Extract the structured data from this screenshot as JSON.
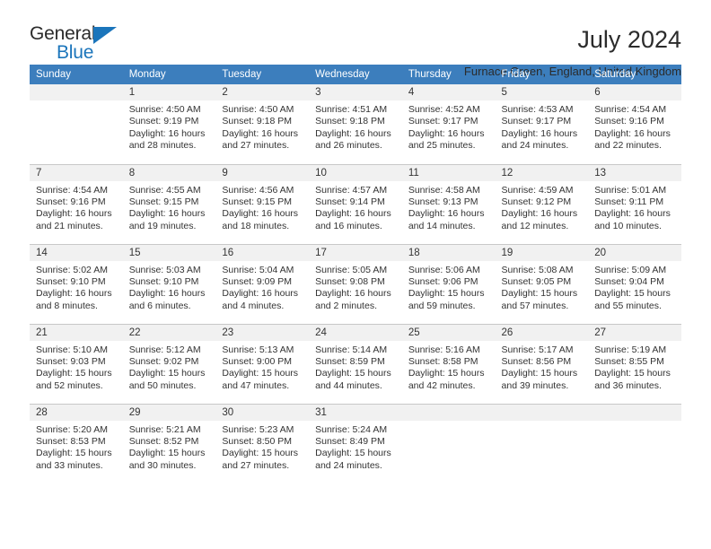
{
  "brand": {
    "name_top": "General",
    "name_bottom": "Blue",
    "triangle_icon": "blue-triangle-icon"
  },
  "header": {
    "title": "July 2024",
    "subtitle": "Furnace Green, England, United Kingdom"
  },
  "colors": {
    "header_blue": "#3c7ebd",
    "daynum_band": "#f1f1f1",
    "brand_blue": "#1b75bb",
    "text": "#333333",
    "row_divider": "#c8c8c8"
  },
  "weekday_headers": [
    "Sunday",
    "Monday",
    "Tuesday",
    "Wednesday",
    "Thursday",
    "Friday",
    "Saturday"
  ],
  "labels": {
    "sunrise_prefix": "Sunrise:",
    "sunset_prefix": "Sunset:",
    "daylight_prefix": "Daylight:"
  },
  "weeks": [
    [
      {
        "day": "",
        "lines": []
      },
      {
        "day": "1",
        "lines": [
          "Sunrise: 4:50 AM",
          "Sunset: 9:19 PM",
          "Daylight: 16 hours and 28 minutes."
        ]
      },
      {
        "day": "2",
        "lines": [
          "Sunrise: 4:50 AM",
          "Sunset: 9:18 PM",
          "Daylight: 16 hours and 27 minutes."
        ]
      },
      {
        "day": "3",
        "lines": [
          "Sunrise: 4:51 AM",
          "Sunset: 9:18 PM",
          "Daylight: 16 hours and 26 minutes."
        ]
      },
      {
        "day": "4",
        "lines": [
          "Sunrise: 4:52 AM",
          "Sunset: 9:17 PM",
          "Daylight: 16 hours and 25 minutes."
        ]
      },
      {
        "day": "5",
        "lines": [
          "Sunrise: 4:53 AM",
          "Sunset: 9:17 PM",
          "Daylight: 16 hours and 24 minutes."
        ]
      },
      {
        "day": "6",
        "lines": [
          "Sunrise: 4:54 AM",
          "Sunset: 9:16 PM",
          "Daylight: 16 hours and 22 minutes."
        ]
      }
    ],
    [
      {
        "day": "7",
        "lines": [
          "Sunrise: 4:54 AM",
          "Sunset: 9:16 PM",
          "Daylight: 16 hours and 21 minutes."
        ]
      },
      {
        "day": "8",
        "lines": [
          "Sunrise: 4:55 AM",
          "Sunset: 9:15 PM",
          "Daylight: 16 hours and 19 minutes."
        ]
      },
      {
        "day": "9",
        "lines": [
          "Sunrise: 4:56 AM",
          "Sunset: 9:15 PM",
          "Daylight: 16 hours and 18 minutes."
        ]
      },
      {
        "day": "10",
        "lines": [
          "Sunrise: 4:57 AM",
          "Sunset: 9:14 PM",
          "Daylight: 16 hours and 16 minutes."
        ]
      },
      {
        "day": "11",
        "lines": [
          "Sunrise: 4:58 AM",
          "Sunset: 9:13 PM",
          "Daylight: 16 hours and 14 minutes."
        ]
      },
      {
        "day": "12",
        "lines": [
          "Sunrise: 4:59 AM",
          "Sunset: 9:12 PM",
          "Daylight: 16 hours and 12 minutes."
        ]
      },
      {
        "day": "13",
        "lines": [
          "Sunrise: 5:01 AM",
          "Sunset: 9:11 PM",
          "Daylight: 16 hours and 10 minutes."
        ]
      }
    ],
    [
      {
        "day": "14",
        "lines": [
          "Sunrise: 5:02 AM",
          "Sunset: 9:10 PM",
          "Daylight: 16 hours and 8 minutes."
        ]
      },
      {
        "day": "15",
        "lines": [
          "Sunrise: 5:03 AM",
          "Sunset: 9:10 PM",
          "Daylight: 16 hours and 6 minutes."
        ]
      },
      {
        "day": "16",
        "lines": [
          "Sunrise: 5:04 AM",
          "Sunset: 9:09 PM",
          "Daylight: 16 hours and 4 minutes."
        ]
      },
      {
        "day": "17",
        "lines": [
          "Sunrise: 5:05 AM",
          "Sunset: 9:08 PM",
          "Daylight: 16 hours and 2 minutes."
        ]
      },
      {
        "day": "18",
        "lines": [
          "Sunrise: 5:06 AM",
          "Sunset: 9:06 PM",
          "Daylight: 15 hours and 59 minutes."
        ]
      },
      {
        "day": "19",
        "lines": [
          "Sunrise: 5:08 AM",
          "Sunset: 9:05 PM",
          "Daylight: 15 hours and 57 minutes."
        ]
      },
      {
        "day": "20",
        "lines": [
          "Sunrise: 5:09 AM",
          "Sunset: 9:04 PM",
          "Daylight: 15 hours and 55 minutes."
        ]
      }
    ],
    [
      {
        "day": "21",
        "lines": [
          "Sunrise: 5:10 AM",
          "Sunset: 9:03 PM",
          "Daylight: 15 hours and 52 minutes."
        ]
      },
      {
        "day": "22",
        "lines": [
          "Sunrise: 5:12 AM",
          "Sunset: 9:02 PM",
          "Daylight: 15 hours and 50 minutes."
        ]
      },
      {
        "day": "23",
        "lines": [
          "Sunrise: 5:13 AM",
          "Sunset: 9:00 PM",
          "Daylight: 15 hours and 47 minutes."
        ]
      },
      {
        "day": "24",
        "lines": [
          "Sunrise: 5:14 AM",
          "Sunset: 8:59 PM",
          "Daylight: 15 hours and 44 minutes."
        ]
      },
      {
        "day": "25",
        "lines": [
          "Sunrise: 5:16 AM",
          "Sunset: 8:58 PM",
          "Daylight: 15 hours and 42 minutes."
        ]
      },
      {
        "day": "26",
        "lines": [
          "Sunrise: 5:17 AM",
          "Sunset: 8:56 PM",
          "Daylight: 15 hours and 39 minutes."
        ]
      },
      {
        "day": "27",
        "lines": [
          "Sunrise: 5:19 AM",
          "Sunset: 8:55 PM",
          "Daylight: 15 hours and 36 minutes."
        ]
      }
    ],
    [
      {
        "day": "28",
        "lines": [
          "Sunrise: 5:20 AM",
          "Sunset: 8:53 PM",
          "Daylight: 15 hours and 33 minutes."
        ]
      },
      {
        "day": "29",
        "lines": [
          "Sunrise: 5:21 AM",
          "Sunset: 8:52 PM",
          "Daylight: 15 hours and 30 minutes."
        ]
      },
      {
        "day": "30",
        "lines": [
          "Sunrise: 5:23 AM",
          "Sunset: 8:50 PM",
          "Daylight: 15 hours and 27 minutes."
        ]
      },
      {
        "day": "31",
        "lines": [
          "Sunrise: 5:24 AM",
          "Sunset: 8:49 PM",
          "Daylight: 15 hours and 24 minutes."
        ]
      },
      {
        "day": "",
        "lines": []
      },
      {
        "day": "",
        "lines": []
      },
      {
        "day": "",
        "lines": []
      }
    ]
  ]
}
